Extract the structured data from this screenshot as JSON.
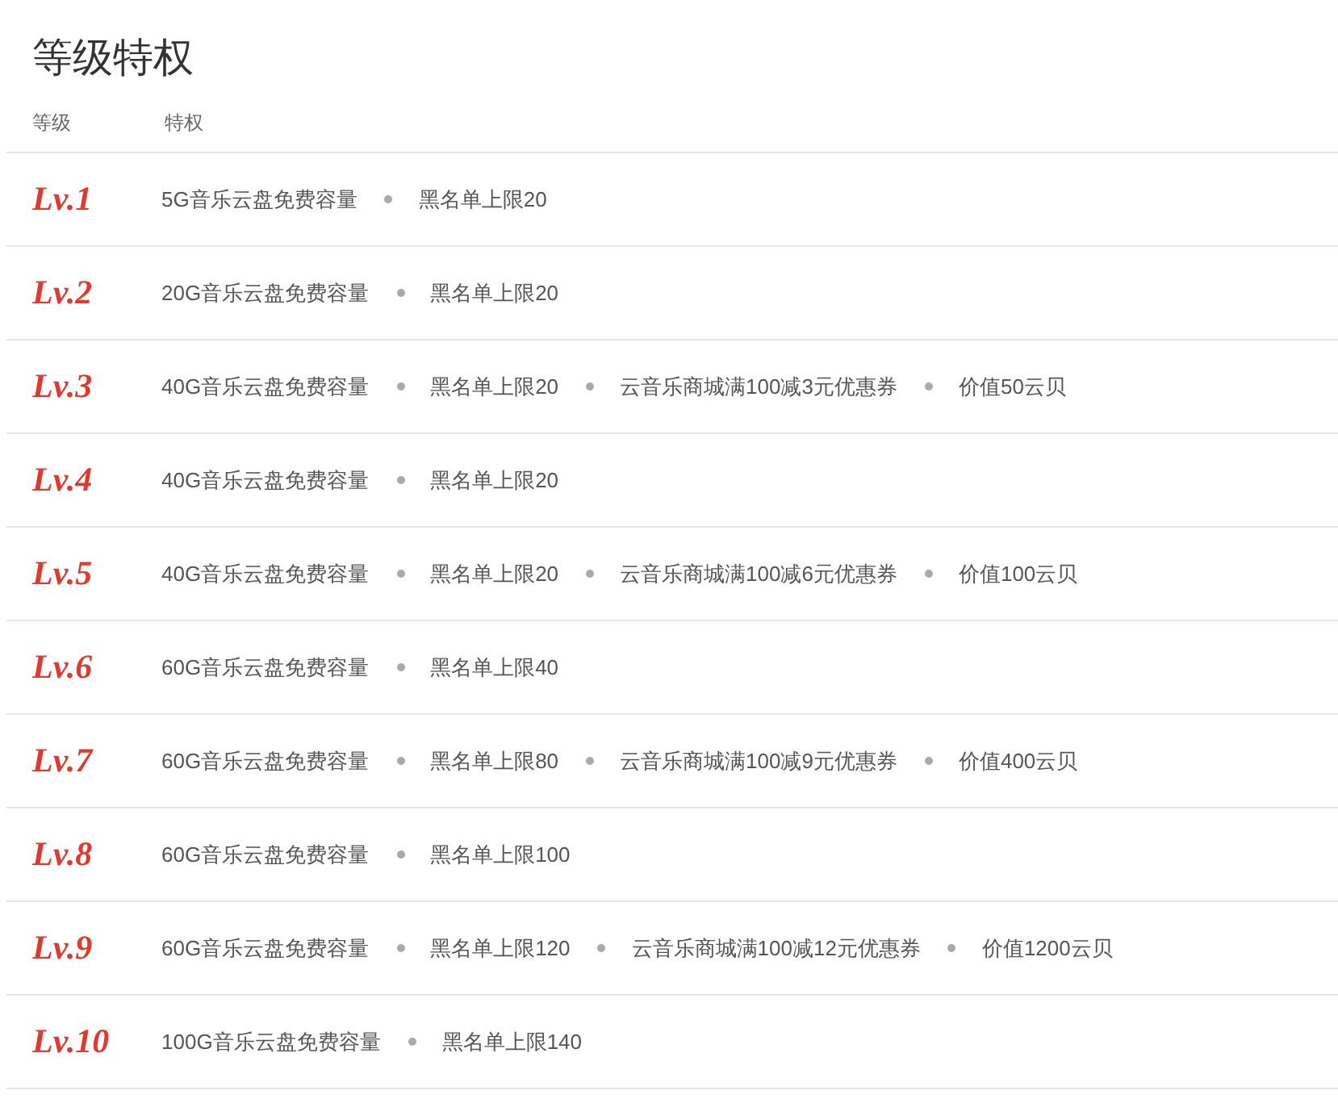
{
  "title": "等级特权",
  "columns": [
    "等级",
    "特权"
  ],
  "levels": [
    {
      "level": "Lv.1",
      "privileges": [
        "5G音乐云盘免费容量",
        "黑名单上限20"
      ]
    },
    {
      "level": "Lv.2",
      "privileges": [
        "20G音乐云盘免费容量",
        "黑名单上限20"
      ]
    },
    {
      "level": "Lv.3",
      "privileges": [
        "40G音乐云盘免费容量",
        "黑名单上限20",
        "云音乐商城满100减3元优惠券",
        "价值50云贝"
      ]
    },
    {
      "level": "Lv.4",
      "privileges": [
        "40G音乐云盘免费容量",
        "黑名单上限20"
      ]
    },
    {
      "level": "Lv.5",
      "privileges": [
        "40G音乐云盘免费容量",
        "黑名单上限20",
        "云音乐商城满100减6元优惠券",
        "价值100云贝"
      ]
    },
    {
      "level": "Lv.6",
      "privileges": [
        "60G音乐云盘免费容量",
        "黑名单上限40"
      ]
    },
    {
      "level": "Lv.7",
      "privileges": [
        "60G音乐云盘免费容量",
        "黑名单上限80",
        "云音乐商城满100减9元优惠券",
        "价值400云贝"
      ]
    },
    {
      "level": "Lv.8",
      "privileges": [
        "60G音乐云盘免费容量",
        "黑名单上限100"
      ]
    },
    {
      "level": "Lv.9",
      "privileges": [
        "60G音乐云盘免费容量",
        "黑名单上限120",
        "云音乐商城满100减12元优惠券",
        "价值1200云贝"
      ]
    },
    {
      "level": "Lv.10",
      "privileges": [
        "100G音乐云盘免费容量",
        "黑名单上限140"
      ]
    }
  ]
}
